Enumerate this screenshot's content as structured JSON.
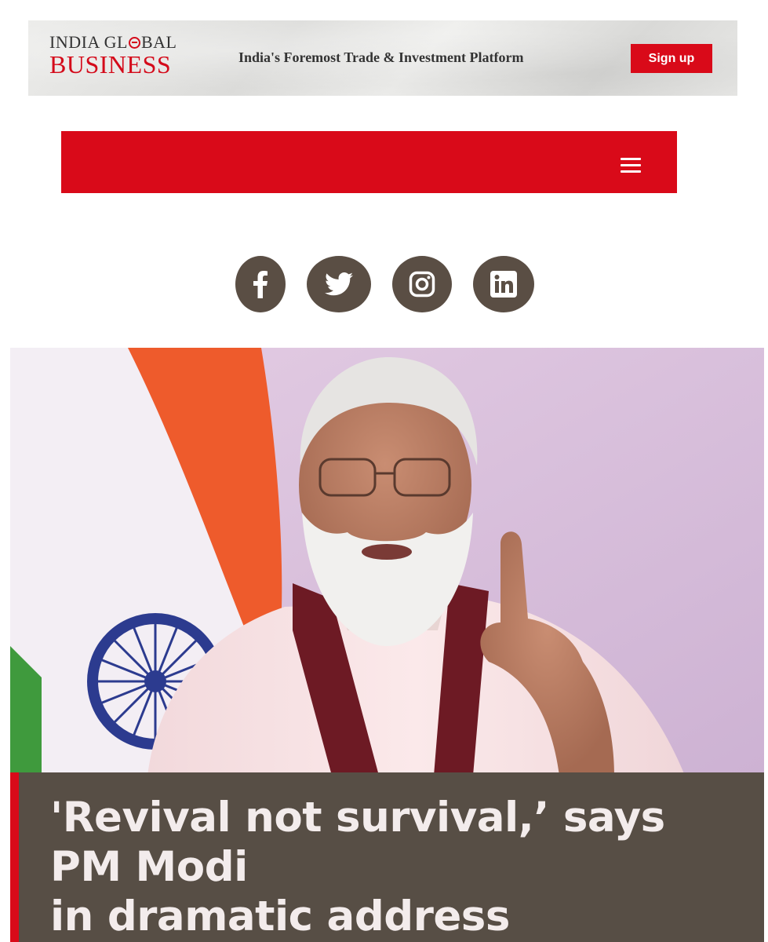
{
  "banner": {
    "logo_line1_a": "INDIA GL",
    "logo_line1_b": "BAL",
    "logo_line2": "BUSINESS",
    "tagline": "India's Foremost Trade & Investment Platform",
    "signup_label": "Sign up"
  },
  "nav": {
    "menu_icon": "hamburger-menu-icon"
  },
  "social": {
    "items": [
      {
        "name": "facebook",
        "icon": "facebook-icon"
      },
      {
        "name": "twitter",
        "icon": "twitter-icon"
      },
      {
        "name": "instagram",
        "icon": "instagram-icon"
      },
      {
        "name": "linkedin",
        "icon": "linkedin-icon"
      }
    ]
  },
  "article": {
    "headline_lines": [
      "'Revival not survival,’ says",
      "PM Modi",
      "in dramatic address"
    ]
  },
  "colors": {
    "brand_red": "#d90a19",
    "social_bg": "#5a4e44",
    "headline_bg": "#574e45"
  }
}
